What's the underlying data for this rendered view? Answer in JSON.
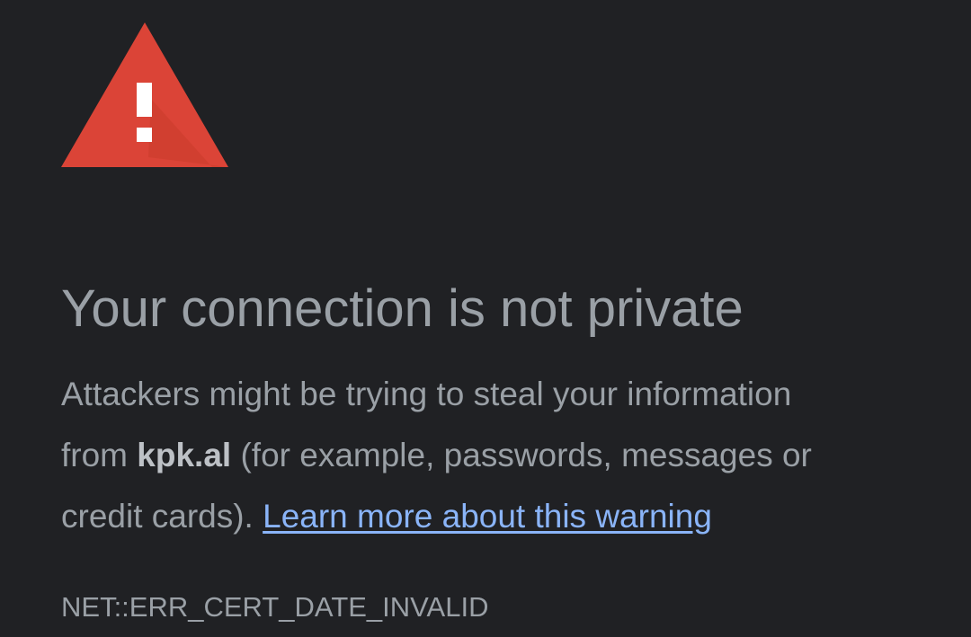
{
  "icon": {
    "name": "warning-triangle-icon",
    "color": "#db4437"
  },
  "heading": "Your connection is not private",
  "body": {
    "line1": "Attackers might be trying to steal your information",
    "line2_prefix": "from ",
    "domain": "kpk.al",
    "line2_suffix": " (for example, passwords, messages or",
    "line3_prefix": "credit cards). ",
    "learn_more_link": "Learn more about this warning"
  },
  "error_code": "NET::ERR_CERT_DATE_INVALID",
  "colors": {
    "background": "#202124",
    "text": "#9aa0a6",
    "link": "#8ab4f8",
    "warning": "#db4437"
  }
}
